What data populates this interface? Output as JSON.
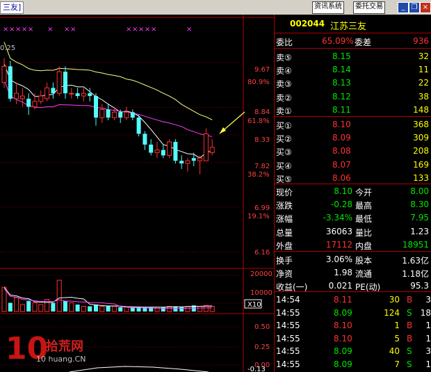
{
  "window": {
    "title": "三友]",
    "buttons": [
      "资讯系统",
      "委托交易"
    ]
  },
  "chart": {
    "price_axis": [
      "9.67",
      "80.9%",
      "8.84",
      "61.8%",
      "8.33",
      "7.82",
      "38.2%",
      "6.99",
      "19.1%",
      "6.16"
    ],
    "top_left_label": "0.25",
    "volume_axis": [
      "20000",
      "10000",
      "X10"
    ],
    "indicator_axis": [
      "0.50",
      "0.25",
      "0.00",
      "-0.13"
    ],
    "markers": [
      "×",
      "×",
      "×",
      "×",
      "×",
      "×",
      "×",
      "×",
      "×",
      "×",
      "×",
      "×",
      "×",
      "×"
    ]
  },
  "chart_data": {
    "type": "candlestick",
    "price_ticks": [
      9.67,
      8.84,
      8.33,
      7.82,
      6.99,
      6.16
    ],
    "fib_labels": [
      "80.9%",
      "61.8%",
      "38.2%",
      "19.1%"
    ],
    "candles": [
      {
        "o": 9.3,
        "c": 9.6,
        "h": 9.75,
        "l": 9.2,
        "color": "red"
      },
      {
        "o": 9.6,
        "c": 9.0,
        "h": 9.7,
        "l": 8.95,
        "color": "cyan"
      },
      {
        "o": 9.0,
        "c": 9.1,
        "h": 9.3,
        "l": 8.9,
        "color": "red"
      },
      {
        "o": 9.0,
        "c": 9.05,
        "h": 9.2,
        "l": 8.85,
        "color": "red"
      },
      {
        "o": 9.0,
        "c": 8.85,
        "h": 9.1,
        "l": 8.7,
        "color": "cyan"
      },
      {
        "o": 8.85,
        "c": 8.95,
        "h": 9.1,
        "l": 8.8,
        "color": "red"
      },
      {
        "o": 8.95,
        "c": 9.05,
        "h": 9.15,
        "l": 8.9,
        "color": "red"
      },
      {
        "o": 9.0,
        "c": 9.2,
        "h": 9.3,
        "l": 8.95,
        "color": "red"
      },
      {
        "o": 9.2,
        "c": 9.1,
        "h": 9.3,
        "l": 9.0,
        "color": "cyan"
      },
      {
        "o": 9.1,
        "c": 9.5,
        "h": 9.6,
        "l": 9.05,
        "color": "red"
      },
      {
        "o": 9.5,
        "c": 9.1,
        "h": 9.6,
        "l": 9.0,
        "color": "cyan"
      },
      {
        "o": 9.1,
        "c": 9.1,
        "h": 9.2,
        "l": 9.0,
        "color": "red"
      },
      {
        "o": 9.1,
        "c": 9.05,
        "h": 9.2,
        "l": 9.0,
        "color": "cyan"
      },
      {
        "o": 9.05,
        "c": 9.1,
        "h": 9.2,
        "l": 8.95,
        "color": "red"
      },
      {
        "o": 9.1,
        "c": 9.05,
        "h": 9.2,
        "l": 8.95,
        "color": "cyan"
      },
      {
        "o": 9.05,
        "c": 8.65,
        "h": 9.1,
        "l": 8.5,
        "color": "cyan"
      },
      {
        "o": 8.65,
        "c": 8.8,
        "h": 8.9,
        "l": 8.55,
        "color": "red"
      },
      {
        "o": 8.8,
        "c": 8.65,
        "h": 8.9,
        "l": 8.6,
        "color": "cyan"
      },
      {
        "o": 8.65,
        "c": 8.75,
        "h": 8.85,
        "l": 8.6,
        "color": "red"
      },
      {
        "o": 8.75,
        "c": 8.65,
        "h": 8.8,
        "l": 8.55,
        "color": "cyan"
      },
      {
        "o": 8.65,
        "c": 8.75,
        "h": 8.85,
        "l": 8.6,
        "color": "red"
      },
      {
        "o": 8.75,
        "c": 8.65,
        "h": 8.8,
        "l": 8.6,
        "color": "cyan"
      },
      {
        "o": 8.65,
        "c": 8.35,
        "h": 8.7,
        "l": 8.3,
        "color": "cyan"
      },
      {
        "o": 8.35,
        "c": 8.15,
        "h": 8.4,
        "l": 8.05,
        "color": "cyan"
      },
      {
        "o": 8.15,
        "c": 8.0,
        "h": 8.25,
        "l": 7.95,
        "color": "cyan"
      },
      {
        "o": 8.0,
        "c": 8.05,
        "h": 8.2,
        "l": 7.9,
        "color": "red"
      },
      {
        "o": 8.05,
        "c": 7.95,
        "h": 8.15,
        "l": 7.9,
        "color": "cyan"
      },
      {
        "o": 7.95,
        "c": 8.2,
        "h": 8.25,
        "l": 7.9,
        "color": "red"
      },
      {
        "o": 8.2,
        "c": 7.85,
        "h": 8.25,
        "l": 7.8,
        "color": "cyan"
      },
      {
        "o": 7.85,
        "c": 7.8,
        "h": 7.95,
        "l": 7.7,
        "color": "cyan"
      },
      {
        "o": 7.8,
        "c": 7.85,
        "h": 7.9,
        "l": 7.65,
        "color": "red"
      },
      {
        "o": 7.85,
        "c": 7.9,
        "h": 8.0,
        "l": 7.75,
        "color": "cyan"
      },
      {
        "o": 7.9,
        "c": 7.85,
        "h": 7.95,
        "l": 7.6,
        "color": "red"
      },
      {
        "o": 7.85,
        "c": 8.35,
        "h": 8.45,
        "l": 7.85,
        "color": "red"
      },
      {
        "o": 8.1,
        "c": 8.0,
        "h": 8.25,
        "l": 7.95,
        "color": "red"
      }
    ],
    "volumes": [
      14000,
      5000,
      8000,
      4000,
      6000,
      5000,
      4000,
      7000,
      5000,
      18000,
      6000,
      5000,
      4000,
      3000,
      3000,
      4000,
      3000,
      3000,
      3000,
      2500,
      2500,
      2500,
      2500,
      2500,
      2500,
      2500,
      2500,
      3000,
      3000,
      2500,
      3000,
      3500,
      3000,
      3500,
      3000
    ]
  },
  "quote": {
    "code": "002044",
    "name": "江苏三友",
    "weibi_label": "委比",
    "weibi_value": "65.09%",
    "weicha_label": "委差",
    "weicha_value": "936",
    "sell": [
      {
        "label": "卖⑤",
        "price": "8.15",
        "vol": "32"
      },
      {
        "label": "卖④",
        "price": "8.14",
        "vol": "11"
      },
      {
        "label": "卖③",
        "price": "8.13",
        "vol": "22"
      },
      {
        "label": "卖②",
        "price": "8.12",
        "vol": "38"
      },
      {
        "label": "卖①",
        "price": "8.11",
        "vol": "148"
      }
    ],
    "buy": [
      {
        "label": "买①",
        "price": "8.10",
        "vol": "368"
      },
      {
        "label": "买②",
        "price": "8.09",
        "vol": "309"
      },
      {
        "label": "买③",
        "price": "8.08",
        "vol": "208"
      },
      {
        "label": "买④",
        "price": "8.07",
        "vol": "169"
      },
      {
        "label": "买⑤",
        "price": "8.06",
        "vol": "133"
      }
    ],
    "stats": [
      {
        "l1": "现价",
        "v1": "8.10",
        "c1": "grn",
        "l2": "今开",
        "v2": "8.00",
        "c2": "grn"
      },
      {
        "l1": "涨跌",
        "v1": "-0.28",
        "c1": "grn",
        "l2": "最高",
        "v2": "8.30",
        "c2": "grn"
      },
      {
        "l1": "涨幅",
        "v1": "-3.34%",
        "c1": "grn",
        "l2": "最低",
        "v2": "7.95",
        "c2": "grn"
      },
      {
        "l1": "总量",
        "v1": "36063",
        "c1": "wht",
        "l2": "量比",
        "v2": "1.23",
        "c2": "wht"
      },
      {
        "l1": "外盘",
        "v1": "17112",
        "c1": "red",
        "l2": "内盘",
        "v2": "18951",
        "c2": "grn"
      }
    ],
    "stats2": [
      {
        "l1": "换手",
        "v1": "3.06%",
        "l2": "股本",
        "v2": "1.63亿"
      },
      {
        "l1": "净资",
        "v1": "1.98",
        "l2": "流通",
        "v2": "1.18亿"
      },
      {
        "l1": "收益(一)",
        "v1": "0.021",
        "l2": "PE(动)",
        "v2": "95.3"
      }
    ],
    "ticks": [
      {
        "time": "14:54",
        "price": "8.11",
        "vol": "30",
        "side": "B",
        "extra": "3"
      },
      {
        "time": "14:55",
        "price": "8.09",
        "vol": "124",
        "side": "S",
        "extra": "18"
      },
      {
        "time": "14:55",
        "price": "8.10",
        "vol": "1",
        "side": "B",
        "extra": "1"
      },
      {
        "time": "14:55",
        "price": "8.10",
        "vol": "5",
        "side": "B",
        "extra": "1"
      },
      {
        "time": "14:55",
        "price": "8.09",
        "vol": "40",
        "side": "S",
        "extra": "3"
      },
      {
        "time": "14:55",
        "price": "8.09",
        "vol": "7",
        "side": "S",
        "extra": "1"
      }
    ]
  },
  "watermark": {
    "digits": "10",
    "cn": "拾荒网",
    "en": "10 huang.CN"
  }
}
